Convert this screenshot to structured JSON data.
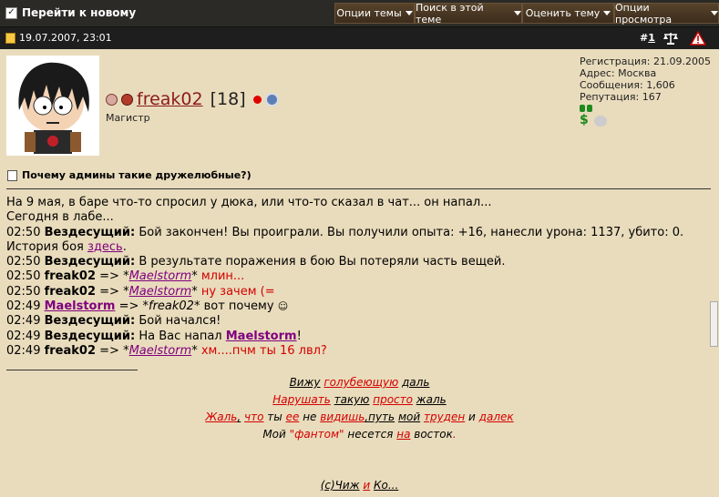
{
  "topbar": {
    "goto_new": "Перейти к новому",
    "buttons": [
      "Опции темы",
      "Поиск в этой теме",
      "Оценить тему",
      "Опции просмотра"
    ]
  },
  "post": {
    "date": "19.07.2007, 23:01",
    "number_prefix": "#",
    "number": "1",
    "user": {
      "name": "freak02",
      "level": "[18]",
      "rank": "Магистр"
    },
    "stats": {
      "registration": "Регистрация: 21.09.2005",
      "address": "Адрес: Москва",
      "messages": "Сообщения: 1,606",
      "reputation": "Репутация: 167"
    },
    "title": "Почему админы такие дружелюбные?)",
    "lines": {
      "l1": "На 9 мая, в баре что-то спросил у дюка, или что-то сказал в чат... он напал...",
      "l2": "Сегодня в лабе...",
      "l3_time": "02:50",
      "l3_name": "Вездесущий:",
      "l3_text": "Бой закончен! Вы проиграли. Вы получили опыта: +16, нанесли урона: 1137, убито: 0.",
      "l4_text": "История боя",
      "l4_link": "здесь",
      "l5_time": "02:50",
      "l5_name": "Вездесущий:",
      "l5_text": "В результате поражения в бою Вы потеряли часть вещей.",
      "l6_time": "02:50",
      "l6_name": "freak02",
      "l6_arrow": "=> *",
      "l6_target": "Maelstorm",
      "l6_star": "*",
      "l6_msg": "млин...",
      "l7_time": "02:50",
      "l7_name": "freak02",
      "l7_arrow": "=> *",
      "l7_target": "Maelstorm",
      "l7_star": "*",
      "l7_msg": "ну зачем (=",
      "l8_time": "02:49",
      "l8_name": "Maelstorm",
      "l8_arrow": "=> *freak02*",
      "l8_msg": "вот почему",
      "l9_time": "02:49",
      "l9_name": "Вездесущий:",
      "l9_text": "Бой начался!",
      "l10_time": "02:49",
      "l10_name": "Вездесущий:",
      "l10_text": "На Вас напал",
      "l10_target": "Maelstorm",
      "l10_end": "!",
      "l11_time": "02:49",
      "l11_name": "freak02",
      "l11_arrow": "=> *",
      "l11_target": "Maelstorm",
      "l11_star": "*",
      "l11_msg": "хм....пчм ты 16 лвл?"
    },
    "signature": {
      "s1a": "Вижу",
      "s1b": "голубеющую",
      "s1c": "даль",
      "s2a": "Нарушать",
      "s2b": "такую",
      "s2c": "просто",
      "s2d": "жаль",
      "s3a": "Жаль",
      "s3b": ",",
      "s3c": "что",
      "s3d": "ты",
      "s3e": "ее",
      "s3f": "не",
      "s3g": "видишь",
      "s3h": ",путь",
      "s3i": "мой",
      "s3j": "труден",
      "s3k": "и",
      "s3l": "далек",
      "s4a": "Мой",
      "s4b": "\"фантом\"",
      "s4c": "несется",
      "s4d": "на",
      "s4e": "восток",
      "s4f": ".",
      "s5a": "(с)",
      "s5b": "Чиж",
      "s5c": "и",
      "s5d": "Ко..."
    }
  },
  "colors": {
    "accent_red": "#d40000",
    "link_purple": "#800080",
    "bg": "#e9dcbc"
  }
}
